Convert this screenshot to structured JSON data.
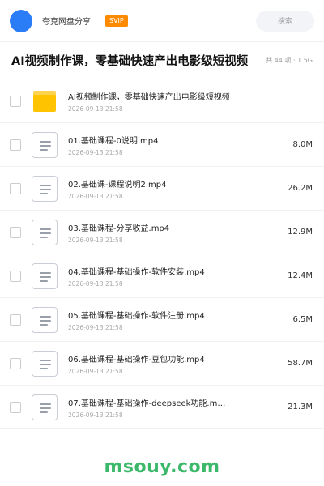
{
  "header": {
    "share_name": "夸克网盘分享",
    "badge": "SVIP",
    "search_placeholder": "搜索",
    "avatar_color": "#2b7cf7",
    "badge_color": "#ff8a00"
  },
  "folder": {
    "title": "AI视频制作课，零基础快速产出电影级短视频",
    "meta": "共 44 项 · 1.5G"
  },
  "items": [
    {
      "name": "AI视频制作课，零基础快速产出电影级短视频",
      "date": "2026-09-13 21:58",
      "size": "",
      "icon": "folder-icon"
    },
    {
      "name": "01.基础课程-0说明.mp4",
      "date": "2026-09-13 21:58",
      "size": "8.0M",
      "icon": "file-icon"
    },
    {
      "name": "02.基础课-课程说明2.mp4",
      "date": "2026-09-13 21:58",
      "size": "26.2M",
      "icon": "file-icon"
    },
    {
      "name": "03.基础课程-分享收益.mp4",
      "date": "2026-09-13 21:58",
      "size": "12.9M",
      "icon": "file-icon"
    },
    {
      "name": "04.基础课程-基础操作-软件安装.mp4",
      "date": "2026-09-13 21:58",
      "size": "12.4M",
      "icon": "file-icon"
    },
    {
      "name": "05.基础课程-基础操作-软件注册.mp4",
      "date": "2026-09-13 21:58",
      "size": "6.5M",
      "icon": "file-icon"
    },
    {
      "name": "06.基础课程-基础操作-豆包功能.mp4",
      "date": "2026-09-13 21:58",
      "size": "58.7M",
      "icon": "file-icon"
    },
    {
      "name": "07.基础课程-基础操作-deepseek功能.m…",
      "date": "2026-09-13 21:58",
      "size": "21.3M",
      "icon": "file-icon"
    }
  ],
  "watermark": {
    "text": "msouy.com",
    "color": "#3cb86a"
  }
}
